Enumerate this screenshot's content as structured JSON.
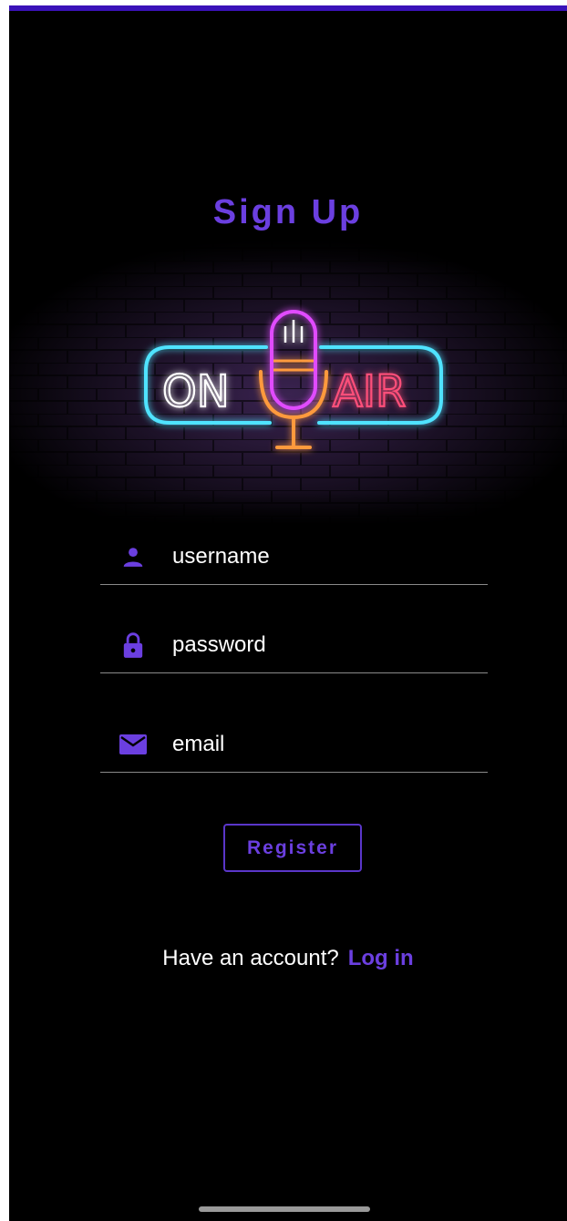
{
  "colors": {
    "accent": "#6b3fe0",
    "status_bar": "#3a12b8",
    "background": "#000000",
    "text": "#ffffff",
    "divider": "#8a8a8a",
    "neon_cyan": "#4fe3ff",
    "neon_magenta": "#e04cff",
    "neon_orange": "#ff9a3c",
    "neon_pink": "#ff4f7a"
  },
  "page": {
    "title": "Sign Up"
  },
  "banner": {
    "left_text": "ON",
    "right_text": "AIR"
  },
  "form": {
    "username": {
      "placeholder": "username",
      "icon": "person-icon"
    },
    "password": {
      "placeholder": "password",
      "icon": "lock-icon"
    },
    "email": {
      "placeholder": "email",
      "icon": "mail-icon"
    }
  },
  "actions": {
    "register_label": "Register",
    "login_prompt": "Have an account?",
    "login_link": "Log in"
  }
}
